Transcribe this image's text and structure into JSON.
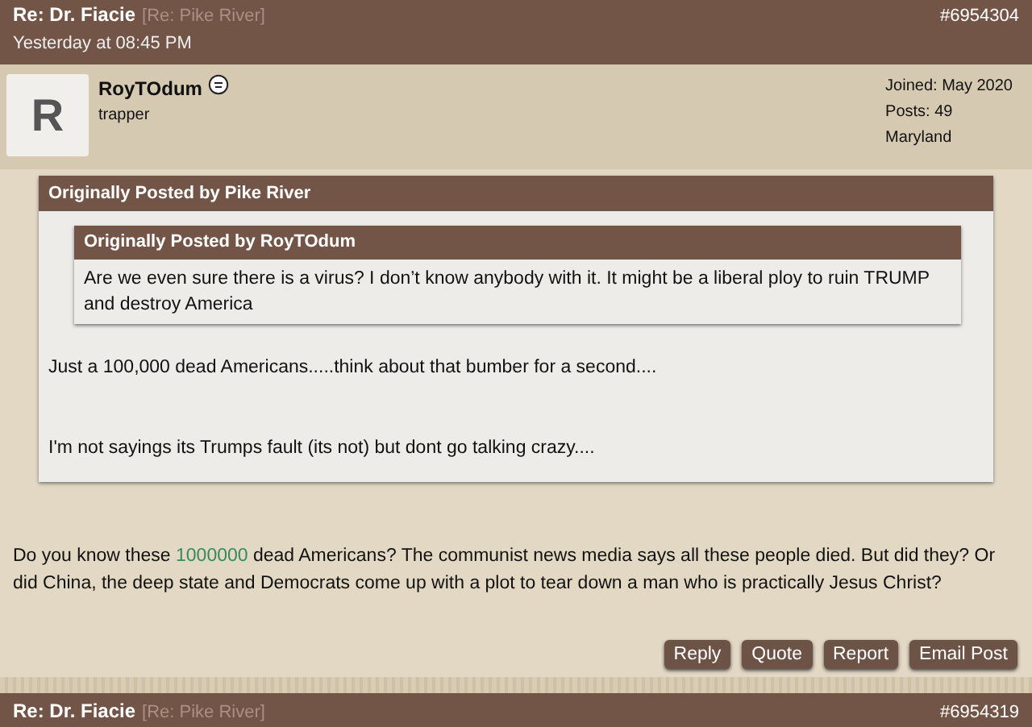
{
  "post_header": {
    "title": "Re: Dr. Fiacie",
    "subtitle": "[Re: Pike River]",
    "number": "#6954304",
    "time": "Yesterday at 08:45 PM"
  },
  "author": {
    "avatar_letter": "R",
    "name": "RoyTOdum",
    "online": false,
    "title": "trapper",
    "stats": [
      "Joined: May 2020",
      "Posts: 49",
      "Maryland"
    ]
  },
  "quote": {
    "header": "Originally Posted by Pike River",
    "inner_quote": {
      "header": "Originally Posted by RoyTOdum",
      "text": "Are we even sure there is a virus? I don’t know anybody with it. It might be a liberal ploy to ruin TRUMP and destroy America"
    },
    "paragraphs": [
      "Just a 100,000 dead Americans.....think about that bumber for a second....",
      "I'm not sayings its Trumps fault (its not) but dont go talking crazy...."
    ]
  },
  "body": [
    {
      "text": "Do you know these ",
      "highlight": false
    },
    {
      "text": "1000000",
      "highlight": true
    },
    {
      "text": " dead Americans? The communist news media says all these people died. But did they? Or did China, the deep state and Democrats come up with a plot to tear down a man who is practically Jesus Christ?",
      "highlight": false
    }
  ],
  "buttons": [
    "Reply",
    "Quote",
    "Report",
    "Email Post"
  ],
  "next_post_header": {
    "title": "Re: Dr. Fiacie",
    "subtitle": "[Re: Pike River]",
    "number": "#6954319"
  }
}
